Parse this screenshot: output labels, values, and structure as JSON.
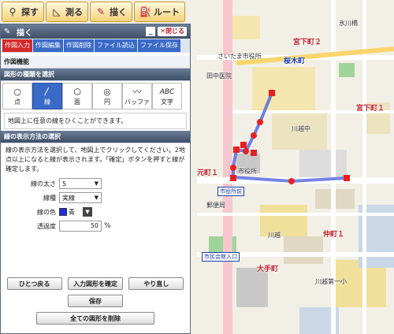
{
  "toolbar": {
    "search": "探す",
    "measure": "測る",
    "draw": "描く",
    "route": "ルート"
  },
  "panel": {
    "title": "描く",
    "close_label": "閉じる",
    "tabs": [
      "作図入力",
      "作図編集",
      "作図削除",
      "ファイル読込",
      "ファイル保存"
    ],
    "function_header": "作図機能",
    "shape_section": "図形の種類を選択",
    "shapes": [
      "点",
      "線",
      "面",
      "円",
      "バッファ",
      "文字"
    ],
    "shape_icons": [
      "○",
      "〳",
      "⬡",
      "◎",
      "〰",
      "ABC"
    ],
    "hint": "地図上に任意の線をひくことができます。",
    "method_section": "線の表示方法の選択",
    "instructions": "線の表示方法を選択して、地図上でクリックしてください。2地点以上になると線が表示されます。「確定」ボタンを押すと線が確定します。",
    "width_label": "線の太さ",
    "width_value": "5",
    "type_label": "線種",
    "type_value": "実線",
    "color_label": "線の色",
    "color_value": "青",
    "opacity_label": "透過度",
    "opacity_value": "50",
    "opacity_unit": "%",
    "btn_back": "ひとつ戻る",
    "btn_confirm": "入力図形を確定",
    "btn_redo": "やり直し",
    "btn_save": "保存",
    "btn_delete_all": "全ての図形を削除"
  },
  "map": {
    "labels": {
      "miyashita2": "宮下町２",
      "miyashita1": "宮下町１",
      "hikawa": "氷川橋",
      "sakai": "さいたま市役所",
      "tanaka": "田中医院",
      "sakuragi": "桜木町",
      "cityhall": "市役所前",
      "motomachi1": "元町１",
      "nakasaka": "仲町１",
      "otemachi": "大手町",
      "jh": "川越中",
      "kawagoe": "川越",
      "post": "郵便局",
      "school": "川越第一小",
      "cityentrance": "市民会館入口",
      "city": "市役所"
    }
  }
}
